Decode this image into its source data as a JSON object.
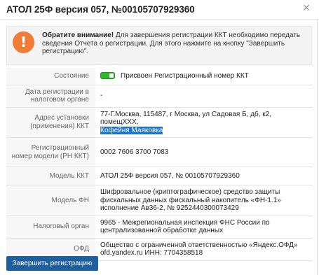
{
  "window": {
    "title": "АТОЛ 25Ф версия 057, №00105707929360",
    "close_glyph": "✕"
  },
  "alert": {
    "icon_glyph": "!",
    "bold": "Обратите внимание!",
    "text": " Для завершения регистрации ККТ необходимо передать сведения Отчета о регистрации. Для этого нажмите на кнопку \"Завершить регистрацию\"."
  },
  "details": {
    "status_label": "Состояние",
    "status_value": "Присвоен Регистрационный номер ККТ",
    "registration_date_label": "Дата регистрации в налоговом органе",
    "registration_date_value": "-",
    "address_label": "Адрес установки (применения) ККТ",
    "address_value": "77-Г.Москва, 115487, г Москва, ул Садовая Б, дб, к2, помещXXX,",
    "address_place": "Кофейня Маяковка",
    "model_reg_number_label": "Регистрационный номер модели (РН ККТ)",
    "model_reg_number_value": "0002 7606 3700 7083",
    "kkt_model_label": "Модель ККТ",
    "kkt_model_value": "АТОЛ 25Ф версия 057, № 00105707929360",
    "fn_model_label": "Модель ФН",
    "fn_model_value": "Шифровальное (криптографическое) средство защиты фискальных данных фискальный накопитель «ФН-1.1» исполнение Ав36-2, № 9252440300073429",
    "tax_authority_label": "Налоговый орган",
    "tax_authority_value": "9965 - Межрегиональная инспекция ФНС России по централизованной обработке данных",
    "ofd_label": "ОФД",
    "ofd_value": "Общество с ограниченной ответственностью «Яндекс.ОФД» ofd.yandex.ru ИНН: 7704358518"
  },
  "actions": {
    "complete_registration_label": "Завершить регистрацию"
  },
  "colors": {
    "alert_icon": "#f07c36",
    "status_on": "#2eb82e",
    "primary_button": "#1f5f9f",
    "selection": "#1a73d9"
  }
}
